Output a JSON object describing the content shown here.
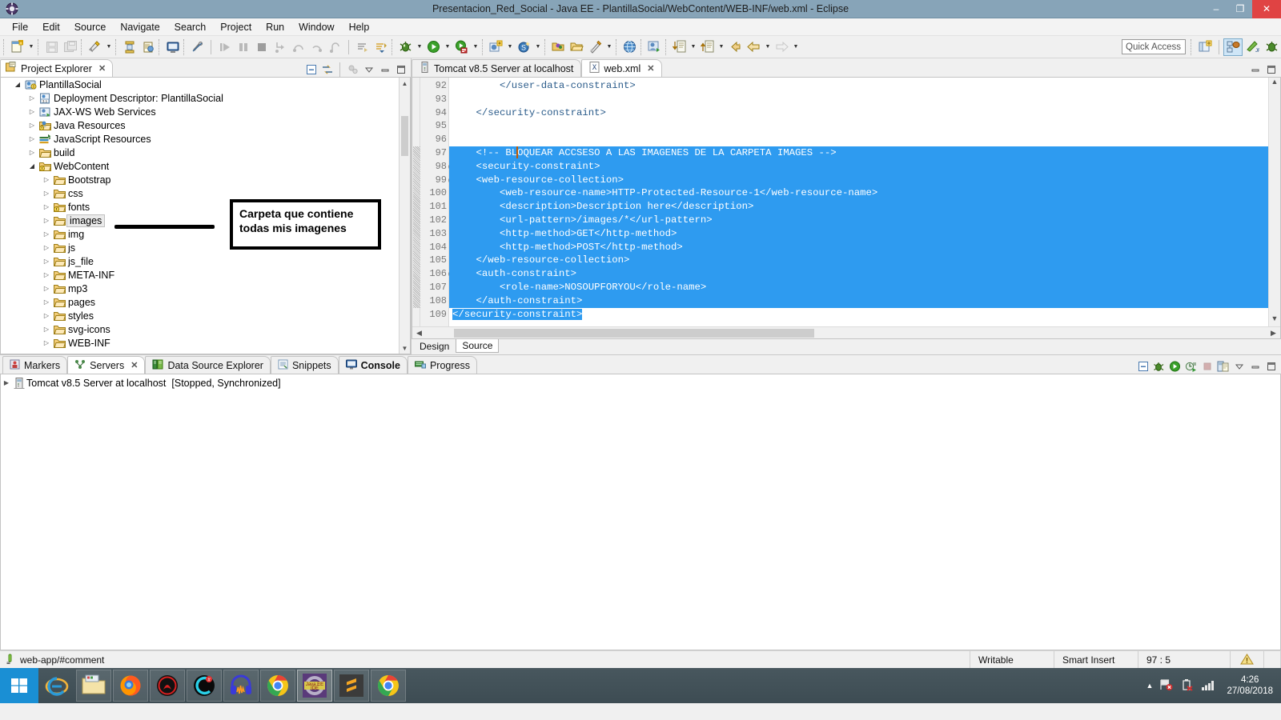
{
  "window": {
    "title": "Presentacion_Red_Social - Java EE - PlantillaSocial/WebContent/WEB-INF/web.xml - Eclipse",
    "minimize_label": "–",
    "maximize_label": "❐",
    "close_label": "✕",
    "app_icon": "eclipse-icon"
  },
  "menubar": {
    "items": [
      {
        "label": "File"
      },
      {
        "label": "Edit"
      },
      {
        "label": "Source"
      },
      {
        "label": "Navigate"
      },
      {
        "label": "Search"
      },
      {
        "label": "Project"
      },
      {
        "label": "Run"
      },
      {
        "label": "Window"
      },
      {
        "label": "Help"
      }
    ]
  },
  "toolbar": {
    "quick_access_placeholder": "Quick Access",
    "quick_access_value": "",
    "icons": [
      "new-wizard-icon",
      "save-icon",
      "save-all-icon",
      "publish-icon",
      "export-icon",
      "print-icon",
      "terminal-icon",
      "toggle-breakpoint-icon",
      "resume-icon",
      "suspend-icon",
      "terminate-icon",
      "step-into-icon",
      "step-over-icon",
      "step-return-icon",
      "drop-to-frame-icon",
      "next-annotation-icon",
      "previous-annotation-icon",
      "debug-icon",
      "run-icon",
      "run-server-icon",
      "new-java-project-icon",
      "new-class-icon",
      "open-type-icon",
      "open-task-icon",
      "search-icon",
      "web-browser-icon",
      "java-browsing-icon",
      "last-edit-icon",
      "back-icon",
      "forward-icon"
    ],
    "perspectives": [
      {
        "name": "open-perspective-icon",
        "active": false
      },
      {
        "name": "java-ee-perspective-icon",
        "active": true
      },
      {
        "name": "junit-perspective-icon",
        "active": false
      },
      {
        "name": "debug-perspective-icon",
        "active": false
      }
    ]
  },
  "project_explorer": {
    "tab_label": "Project Explorer",
    "tab_icon": "project-explorer-icon",
    "tab_close": "✕",
    "view_tools": [
      "collapse-all-icon",
      "link-with-editor-icon",
      "focus-on-active-task-icon",
      "view-menu-icon",
      "minimize-icon",
      "maximize-icon"
    ],
    "tree": [
      {
        "label": "PlantillaSocial",
        "indent": 0,
        "arrow": "open",
        "icon": "web-project-icon",
        "selected": false
      },
      {
        "label": "Deployment Descriptor: PlantillaSocial",
        "indent": 1,
        "arrow": "closed",
        "icon": "deployment-descriptor-icon",
        "selected": false
      },
      {
        "label": "JAX-WS Web Services",
        "indent": 1,
        "arrow": "closed",
        "icon": "jaxws-icon",
        "selected": false
      },
      {
        "label": "Java Resources",
        "indent": 1,
        "arrow": "closed",
        "icon": "java-resources-icon",
        "selected": false
      },
      {
        "label": "JavaScript Resources",
        "indent": 1,
        "arrow": "closed",
        "icon": "javascript-resources-icon",
        "selected": false
      },
      {
        "label": "build",
        "indent": 1,
        "arrow": "closed",
        "icon": "folder-icon",
        "selected": false
      },
      {
        "label": "WebContent",
        "indent": 1,
        "arrow": "open",
        "icon": "folder-warning-icon",
        "selected": false
      },
      {
        "label": "Bootstrap",
        "indent": 2,
        "arrow": "closed",
        "icon": "folder-icon",
        "selected": false
      },
      {
        "label": "css",
        "indent": 2,
        "arrow": "closed",
        "icon": "folder-icon",
        "selected": false
      },
      {
        "label": "fonts",
        "indent": 2,
        "arrow": "closed",
        "icon": "folder-warning-icon",
        "selected": false
      },
      {
        "label": "images",
        "indent": 2,
        "arrow": "closed",
        "icon": "folder-icon",
        "selected": true
      },
      {
        "label": "img",
        "indent": 2,
        "arrow": "closed",
        "icon": "folder-icon",
        "selected": false
      },
      {
        "label": "js",
        "indent": 2,
        "arrow": "closed",
        "icon": "folder-icon",
        "selected": false
      },
      {
        "label": "js_file",
        "indent": 2,
        "arrow": "closed",
        "icon": "folder-icon",
        "selected": false
      },
      {
        "label": "META-INF",
        "indent": 2,
        "arrow": "closed",
        "icon": "folder-icon",
        "selected": false
      },
      {
        "label": "mp3",
        "indent": 2,
        "arrow": "closed",
        "icon": "folder-icon",
        "selected": false
      },
      {
        "label": "pages",
        "indent": 2,
        "arrow": "closed",
        "icon": "folder-icon",
        "selected": false
      },
      {
        "label": "styles",
        "indent": 2,
        "arrow": "closed",
        "icon": "folder-icon",
        "selected": false
      },
      {
        "label": "svg-icons",
        "indent": 2,
        "arrow": "closed",
        "icon": "folder-icon",
        "selected": false
      },
      {
        "label": "WEB-INF",
        "indent": 2,
        "arrow": "closed",
        "icon": "folder-icon",
        "selected": false
      }
    ]
  },
  "annotation": {
    "line1": "Carpeta que contiene",
    "line2": "todas mis imagenes",
    "border_color": "#000000",
    "pointer": "annotation-pointer-line"
  },
  "editor": {
    "tabs": [
      {
        "label": "Tomcat v8.5 Server at localhost",
        "icon": "server-editor-icon",
        "active": false,
        "close": ""
      },
      {
        "label": "web.xml",
        "icon": "xml-file-icon",
        "active": true,
        "close": "✕"
      }
    ],
    "view_tools": [
      "minimize-icon",
      "maximize-icon"
    ],
    "first_line_number": 92,
    "lines": [
      {
        "n": 92,
        "text": "        </user-data-constraint>",
        "selected": false,
        "fold": false
      },
      {
        "n": 93,
        "text": "",
        "selected": false,
        "fold": false
      },
      {
        "n": 94,
        "text": "    </security-constraint>",
        "selected": false,
        "fold": false
      },
      {
        "n": 95,
        "text": "",
        "selected": false,
        "fold": false
      },
      {
        "n": 96,
        "text": "",
        "selected": false,
        "fold": false
      },
      {
        "n": 97,
        "text": "    <!-- BLOQUEAR ACCSESO A LAS IMAGENES DE LA CARPETA IMAGES -->",
        "selected": true,
        "fold": false
      },
      {
        "n": 98,
        "text": "    <security-constraint>",
        "selected": true,
        "fold": true
      },
      {
        "n": 99,
        "text": "    <web-resource-collection>",
        "selected": true,
        "fold": true
      },
      {
        "n": 100,
        "text": "        <web-resource-name>HTTP-Protected-Resource-1</web-resource-name>",
        "selected": true,
        "fold": false
      },
      {
        "n": 101,
        "text": "        <description>Description here</description>",
        "selected": true,
        "fold": false
      },
      {
        "n": 102,
        "text": "        <url-pattern>/images/*</url-pattern>",
        "selected": true,
        "fold": false
      },
      {
        "n": 103,
        "text": "        <http-method>GET</http-method>",
        "selected": true,
        "fold": false
      },
      {
        "n": 104,
        "text": "        <http-method>POST</http-method>",
        "selected": true,
        "fold": false
      },
      {
        "n": 105,
        "text": "    </web-resource-collection>",
        "selected": true,
        "fold": false
      },
      {
        "n": 106,
        "text": "    <auth-constraint>",
        "selected": true,
        "fold": true
      },
      {
        "n": 107,
        "text": "        <role-name>NOSOUPFORYOU</role-name>",
        "selected": true,
        "fold": false
      },
      {
        "n": 108,
        "text": "    </auth-constraint>",
        "selected": true,
        "fold": false
      },
      {
        "n": 109,
        "text": "</security-constraint>",
        "selected": "partial",
        "fold": false
      }
    ],
    "bottom_tabs": [
      {
        "label": "Design",
        "active": false
      },
      {
        "label": "Source",
        "active": true
      }
    ]
  },
  "bottom_panel": {
    "tabs": [
      {
        "label": "Markers",
        "icon": "markers-icon",
        "active": false,
        "bold": false,
        "close": ""
      },
      {
        "label": "Servers",
        "icon": "servers-icon",
        "active": true,
        "bold": false,
        "close": "✕"
      },
      {
        "label": "Data Source Explorer",
        "icon": "data-source-icon",
        "active": false,
        "bold": false,
        "close": ""
      },
      {
        "label": "Snippets",
        "icon": "snippets-icon",
        "active": false,
        "bold": false,
        "close": ""
      },
      {
        "label": "Console",
        "icon": "console-icon",
        "active": false,
        "bold": true,
        "close": ""
      },
      {
        "label": "Progress",
        "icon": "progress-icon",
        "active": false,
        "bold": false,
        "close": ""
      }
    ],
    "view_tools": [
      "collapse-all-icon",
      "debug-server-icon",
      "start-server-icon",
      "profile-server-icon",
      "stop-server-icon",
      "publish-server-icon",
      "view-menu-icon",
      "minimize-icon",
      "maximize-icon"
    ],
    "rows": [
      {
        "arrow": "closed",
        "icon": "server-icon",
        "name": "Tomcat v8.5 Server at localhost",
        "state": "[Stopped, Synchronized]"
      }
    ]
  },
  "statusbar": {
    "left_icon": "xml-marker-icon",
    "left_text": "web-app/#comment",
    "writable": "Writable",
    "insert_mode": "Smart Insert",
    "position": "97 : 5",
    "right_icon": "warning-icon"
  },
  "taskbar": {
    "start_icon": "windows-start-icon",
    "apps": [
      {
        "name": "internet-explorer-icon",
        "grouped": false,
        "active": false
      },
      {
        "name": "file-explorer-icon",
        "grouped": true,
        "active": false
      },
      {
        "name": "firefox-icon",
        "grouped": true,
        "active": false
      },
      {
        "name": "red-app-icon",
        "grouped": true,
        "active": false
      },
      {
        "name": "teal-app-icon",
        "grouped": true,
        "active": false
      },
      {
        "name": "audacity-icon",
        "grouped": true,
        "active": false
      },
      {
        "name": "chrome-icon",
        "grouped": true,
        "active": false
      },
      {
        "name": "eclipse-javaee-icon",
        "grouped": true,
        "active": true
      },
      {
        "name": "sublime-text-icon",
        "grouped": true,
        "active": false
      },
      {
        "name": "chrome-window-icon",
        "grouped": true,
        "active": false
      }
    ],
    "tray": {
      "show_hidden": "show-hidden-icons-icon",
      "icons": [
        "network-flag-error-icon",
        "battery-error-icon",
        "signal-bars-icon"
      ],
      "time": "4:26",
      "date": "27/08/2018"
    }
  }
}
